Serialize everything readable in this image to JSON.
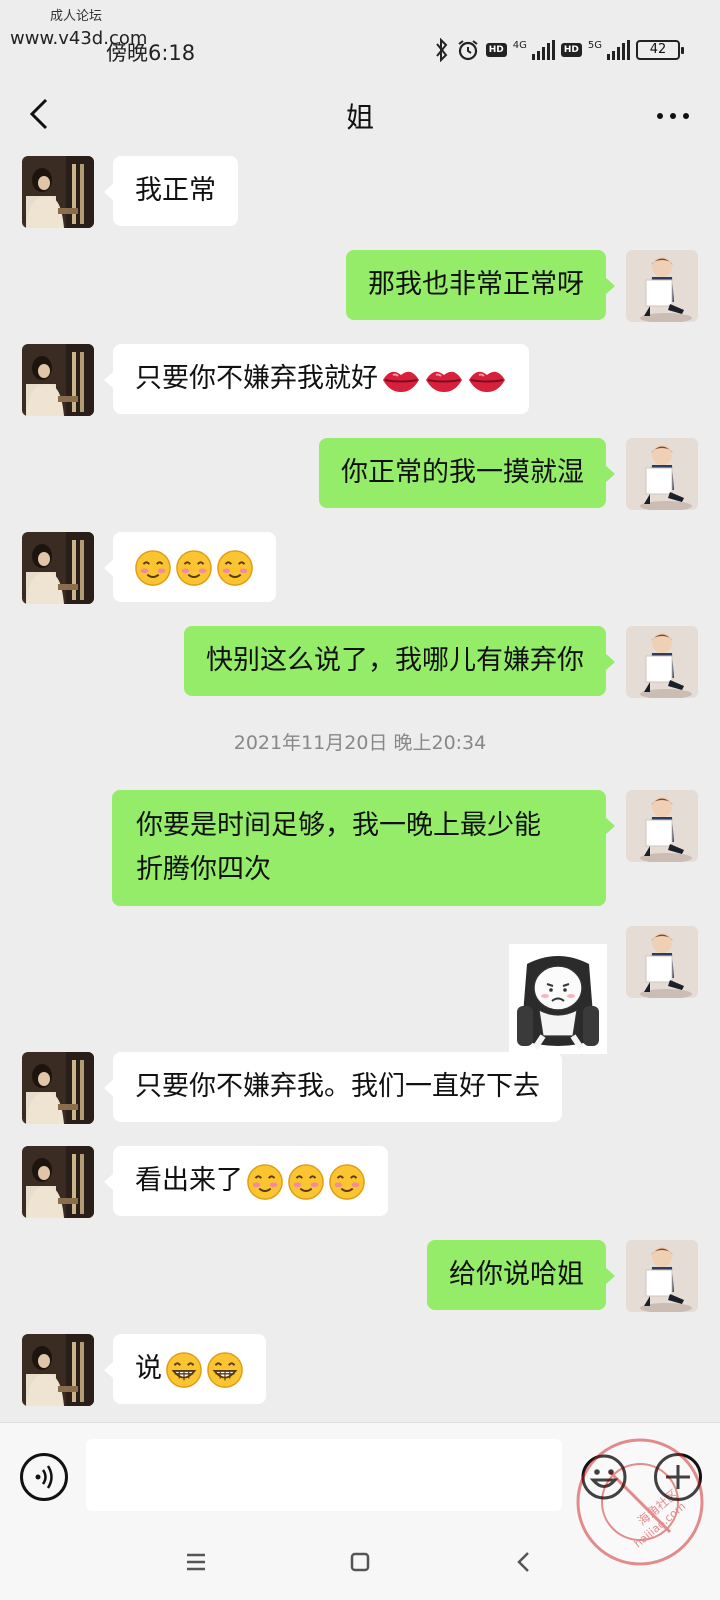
{
  "watermark": {
    "line1": "成人论坛",
    "line2": "www.v43d.com",
    "corner_line1": "海角社区",
    "corner_line2": "haijiao.com"
  },
  "status_bar": {
    "time": "傍晚6:18",
    "hd1": "HD",
    "net1": "4G",
    "hd2": "HD",
    "net2": "5G",
    "battery": "42"
  },
  "header": {
    "title": "姐",
    "back_icon": "chevron-left-icon",
    "more_icon": "more-dots-icon"
  },
  "messages": [
    {
      "from": "her",
      "text": "我正常"
    },
    {
      "from": "me",
      "text": "那我也非常正常呀"
    },
    {
      "from": "her",
      "text": "只要你不嫌弃我就好",
      "emoji": [
        "lips",
        "lips",
        "lips"
      ]
    },
    {
      "from": "me",
      "text": "你正常的我一摸就湿"
    },
    {
      "from": "her",
      "text": "",
      "emoji": [
        "blush-smile",
        "blush-smile",
        "blush-smile"
      ]
    },
    {
      "from": "me",
      "text": "快别这么说了，我哪儿有嫌弃你"
    },
    {
      "type": "timestamp",
      "text": "2021年11月20日 晚上20:34"
    },
    {
      "from": "me",
      "text_line1": "你要是时间足够，我一晚上最少能",
      "text_line2": "折腾你四次"
    },
    {
      "from": "me",
      "type": "sticker",
      "sticker": "sad-face-in-armchair-sticker"
    },
    {
      "from": "her",
      "text": "只要你不嫌弃我。我们一直好下去"
    },
    {
      "from": "her",
      "text": "看出来了",
      "emoji": [
        "blush-smile",
        "blush-smile",
        "blush-smile"
      ]
    },
    {
      "from": "me",
      "text": "给你说哈姐"
    },
    {
      "from": "her",
      "text": "说",
      "emoji": [
        "grin",
        "grin"
      ]
    }
  ],
  "input_bar": {
    "value": "",
    "voice_icon": "voice-icon",
    "emoji_icon": "emoji-icon",
    "plus_icon": "plus-icon"
  },
  "nav_bar": {
    "menu_icon": "menu-icon",
    "home_icon": "home-square-icon",
    "back_icon": "back-triangle-icon"
  },
  "colors": {
    "background": "#ededed",
    "bubble_out": "#95ec69",
    "bubble_in": "#ffffff",
    "timestamp": "#888888"
  }
}
